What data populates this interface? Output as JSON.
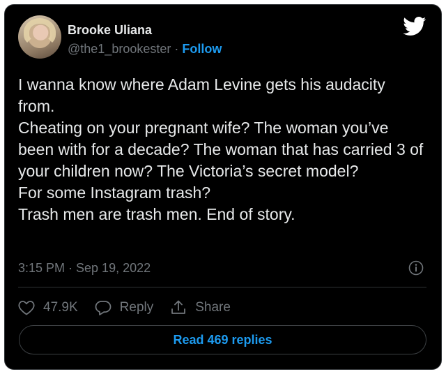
{
  "tweet": {
    "author_name": "Brooke Uliana",
    "handle": "@the1_brookester",
    "separator": " · ",
    "follow_label": "Follow",
    "text": "I wanna know where Adam Levine  gets his audacity from.\nCheating on your pregnant wife? The woman you’ve been with for a decade? The woman that has carried 3 of your children now? The Victoria’s secret model?\nFor some Instagram trash?\nTrash men are trash men. End of story.",
    "timestamp": "3:15 PM · Sep 19, 2022",
    "likes": "47.9K",
    "reply_label": "Reply",
    "share_label": "Share",
    "read_replies_label": "Read 469 replies"
  },
  "icons": {
    "logo": "twitter-bird-icon",
    "info": "info-icon",
    "like": "heart-icon",
    "reply": "speech-bubble-icon",
    "share": "share-icon"
  },
  "colors": {
    "background": "#000000",
    "text": "#e7e9ea",
    "secondary": "#71767b",
    "accent": "#1d9bf0"
  }
}
